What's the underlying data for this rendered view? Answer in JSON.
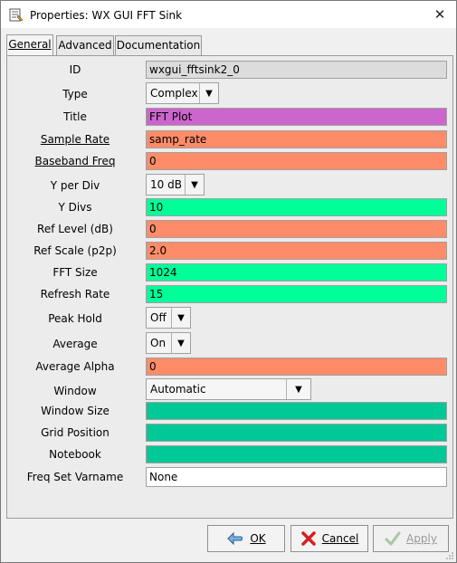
{
  "window": {
    "title": "Properties: WX GUI FFT Sink"
  },
  "tabs": [
    {
      "label": "General"
    },
    {
      "label": "Advanced"
    },
    {
      "label": "Documentation"
    }
  ],
  "fields": {
    "id": {
      "label": "ID",
      "value": "wxgui_fftsink2_0"
    },
    "type": {
      "label": "Type",
      "value": "Complex"
    },
    "title": {
      "label": "Title",
      "value": "FFT Plot"
    },
    "sample_rate": {
      "label": "Sample Rate",
      "value": "samp_rate"
    },
    "baseband_freq": {
      "label": "Baseband Freq",
      "value": "0"
    },
    "y_per_div": {
      "label": "Y per Div",
      "value": "10 dB"
    },
    "y_divs": {
      "label": "Y Divs",
      "value": "10"
    },
    "ref_level": {
      "label": "Ref Level (dB)",
      "value": "0"
    },
    "ref_scale": {
      "label": "Ref Scale (p2p)",
      "value": "2.0"
    },
    "fft_size": {
      "label": "FFT Size",
      "value": "1024"
    },
    "refresh_rate": {
      "label": "Refresh Rate",
      "value": "15"
    },
    "peak_hold": {
      "label": "Peak Hold",
      "value": "Off"
    },
    "average": {
      "label": "Average",
      "value": "On"
    },
    "average_alpha": {
      "label": "Average Alpha",
      "value": "0"
    },
    "window": {
      "label": "Window",
      "value": "Automatic"
    },
    "window_size": {
      "label": "Window Size",
      "value": ""
    },
    "grid_position": {
      "label": "Grid Position",
      "value": ""
    },
    "notebook": {
      "label": "Notebook",
      "value": ""
    },
    "freq_set_varname": {
      "label": "Freq Set Varname",
      "value": "None"
    }
  },
  "buttons": {
    "ok": "OK",
    "cancel": "Cancel",
    "apply": "Apply"
  },
  "colors": {
    "readonly": "#dcdcdc",
    "string": "#cc66cc",
    "float": "#ff8c69",
    "int": "#00ff99",
    "grid": "#00c896",
    "raw": "#ffffff"
  }
}
